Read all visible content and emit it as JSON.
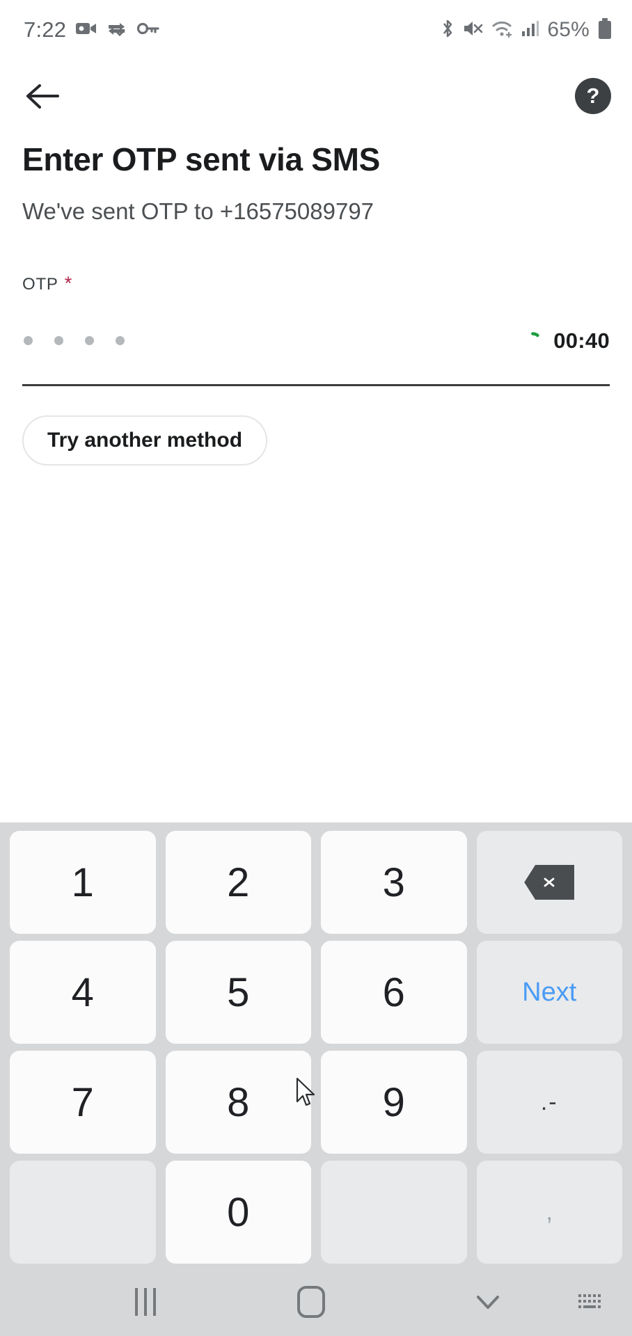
{
  "statusbar": {
    "time": "7:22",
    "battery_percent": "65%",
    "icons": [
      "video-camera-icon",
      "data-saver-icon",
      "vpn-key-icon",
      "bluetooth-icon",
      "mute-icon",
      "wifi-icon",
      "cellular-signal-icon",
      "battery-icon"
    ]
  },
  "appbar": {
    "back_label": "back-arrow",
    "help_label": "?"
  },
  "main": {
    "title": "Enter OTP sent via SMS",
    "subtitle": "We've sent OTP to +16575089797",
    "field_label": "OTP",
    "required_marker": "*",
    "otp_dot_count": 4,
    "otp_value": "",
    "timer": "00:40",
    "alt_method_label": "Try another method",
    "accent_timer_color": "#1a1c1e",
    "spinner_color": "#1e9e3e",
    "required_color": "#b0214a"
  },
  "keyboard": {
    "rows": [
      [
        {
          "label": "1",
          "name": "key-1",
          "type": "digit"
        },
        {
          "label": "2",
          "name": "key-2",
          "type": "digit"
        },
        {
          "label": "3",
          "name": "key-3",
          "type": "digit"
        },
        {
          "label": "",
          "name": "key-backspace",
          "type": "backspace"
        }
      ],
      [
        {
          "label": "4",
          "name": "key-4",
          "type": "digit"
        },
        {
          "label": "5",
          "name": "key-5",
          "type": "digit"
        },
        {
          "label": "6",
          "name": "key-6",
          "type": "digit"
        },
        {
          "label": "Next",
          "name": "key-next",
          "type": "next"
        }
      ],
      [
        {
          "label": "7",
          "name": "key-7",
          "type": "digit"
        },
        {
          "label": "8",
          "name": "key-8",
          "type": "digit"
        },
        {
          "label": "9",
          "name": "key-9",
          "type": "digit"
        },
        {
          "label": ".-",
          "name": "key-punctuation",
          "type": "punct"
        }
      ],
      [
        {
          "label": "",
          "name": "key-blank-left",
          "type": "blank"
        },
        {
          "label": "0",
          "name": "key-0",
          "type": "digit"
        },
        {
          "label": "",
          "name": "key-blank-right",
          "type": "blank"
        },
        {
          "label": ",",
          "name": "key-comma",
          "type": "comma"
        }
      ]
    ]
  },
  "navbar": {
    "recents": "recents-icon",
    "home": "home-icon",
    "hide_keyboard": "chevron-down-icon",
    "keyboard_switch": "keyboard-icon"
  }
}
